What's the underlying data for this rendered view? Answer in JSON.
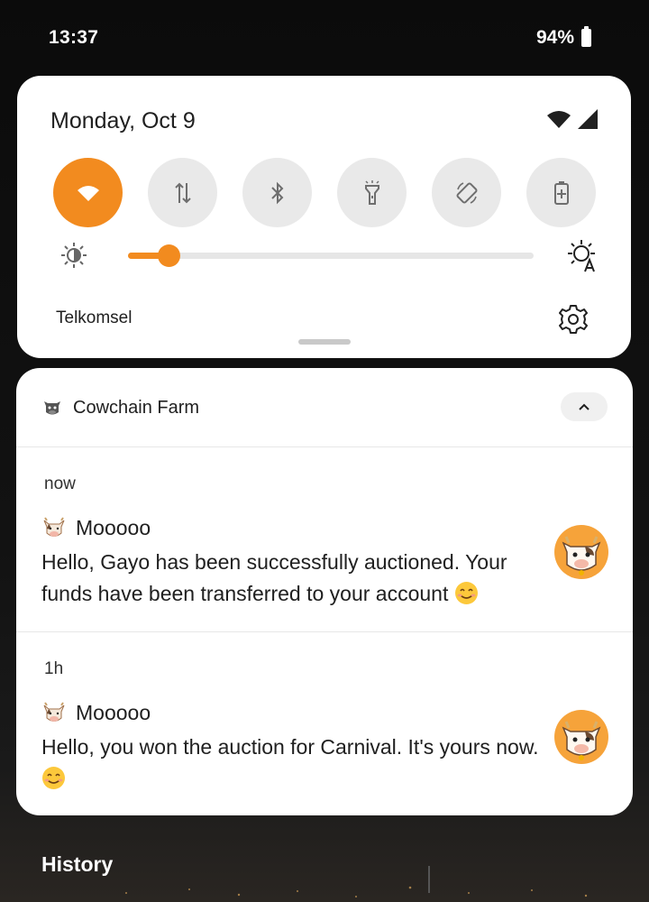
{
  "status_bar": {
    "time": "13:37",
    "battery_percent": "94%"
  },
  "quick_settings": {
    "date": "Monday, Oct 9",
    "tiles": [
      {
        "name": "wifi",
        "icon": "wifi-icon",
        "active": true
      },
      {
        "name": "mobile-data",
        "icon": "data-transfer-icon",
        "active": false
      },
      {
        "name": "bluetooth",
        "icon": "bluetooth-icon",
        "active": false
      },
      {
        "name": "flashlight",
        "icon": "flashlight-icon",
        "active": false
      },
      {
        "name": "auto-rotate",
        "icon": "auto-rotate-icon",
        "active": false
      },
      {
        "name": "battery-saver",
        "icon": "battery-saver-icon",
        "active": false
      }
    ],
    "brightness_level": 0.1,
    "carrier": "Telkomsel"
  },
  "notification_group": {
    "app_name": "Cowchain Farm",
    "items": [
      {
        "time": "now",
        "title": "Mooooo",
        "body": "Hello, Gayo has been successfully auctioned. Your funds have been transferred to your account"
      },
      {
        "time": "1h",
        "title": "Mooooo",
        "body": "Hello, you won the auction for Carnival. It's yours now."
      }
    ]
  },
  "history_label": "History",
  "colors": {
    "accent": "#f28b1f",
    "tile_inactive": "#e9e9e9",
    "panel": "#ffffff"
  }
}
